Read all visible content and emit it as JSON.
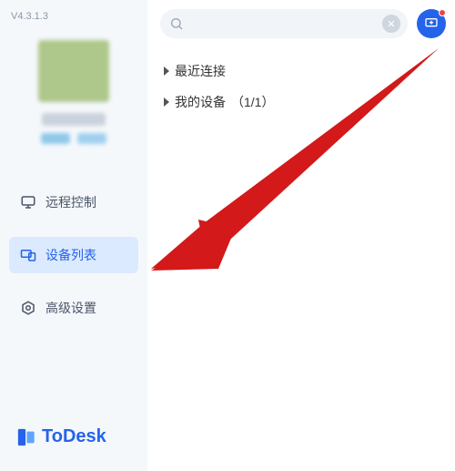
{
  "version": "V4.3.1.3",
  "sidebar": {
    "nav": [
      {
        "label": "远程控制"
      },
      {
        "label": "设备列表"
      },
      {
        "label": "高级设置"
      }
    ]
  },
  "brand": {
    "name": "ToDesk"
  },
  "search": {
    "placeholder": ""
  },
  "tree": {
    "recent": "最近连接",
    "mydevices_prefix": "我的设备",
    "mydevices_count": "（1/1）"
  },
  "colors": {
    "accent": "#2563eb",
    "arrow": "#d31919"
  }
}
